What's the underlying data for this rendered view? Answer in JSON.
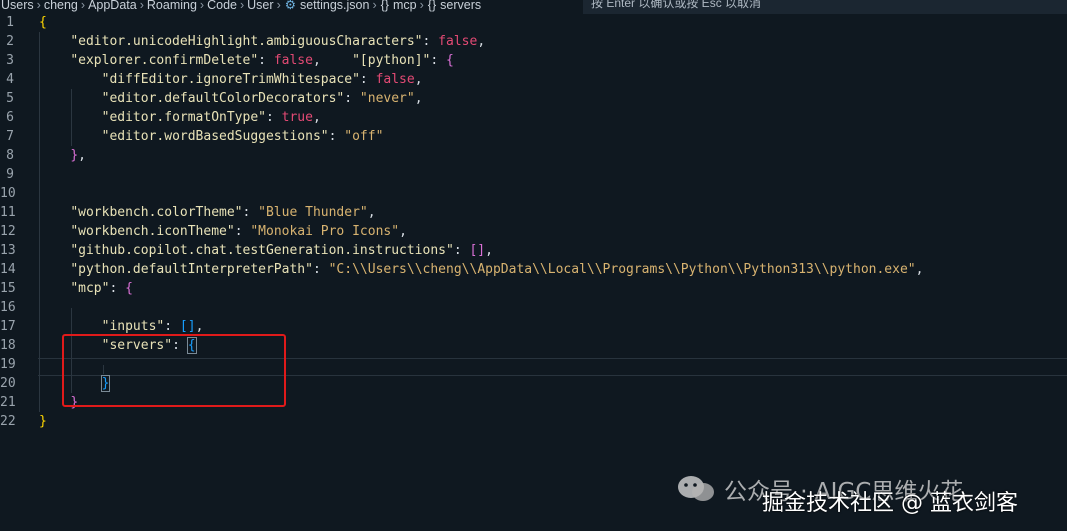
{
  "breadcrumb": {
    "items": [
      "Users",
      "cheng",
      "AppData",
      "Roaming",
      "Code",
      "User",
      "settings.json",
      "mcp",
      "servers"
    ]
  },
  "hint": {
    "text": "按 Enter 以确认或按 Esc 以取消"
  },
  "editor": {
    "line_numbers": [
      "1",
      "2",
      "3",
      "4",
      "5",
      "6",
      "7",
      "8",
      "9",
      "10",
      "11",
      "12",
      "13",
      "14",
      "15",
      "16",
      "17",
      "18",
      "19",
      "20",
      "21",
      "22"
    ],
    "lines": {
      "l1_open": "{",
      "l2_key": "\"editor.unicodeHighlight.ambiguousCharacters\"",
      "l2_val": "false",
      "l3_key": "\"explorer.confirmDelete\"",
      "l3_val": "false",
      "l3_key2": "\"[python]\"",
      "l3_brace": "{",
      "l4_key": "\"diffEditor.ignoreTrimWhitespace\"",
      "l4_val": "false",
      "l5_key": "\"editor.defaultColorDecorators\"",
      "l5_val": "\"never\"",
      "l6_key": "\"editor.formatOnType\"",
      "l6_val": "true",
      "l7_key": "\"editor.wordBasedSuggestions\"",
      "l7_val": "\"off\"",
      "l8_close": "}",
      "l11_key": "\"workbench.colorTheme\"",
      "l11_val": "\"Blue Thunder\"",
      "l12_key": "\"workbench.iconTheme\"",
      "l12_val": "\"Monokai Pro Icons\"",
      "l13_key": "\"github.copilot.chat.testGeneration.instructions\"",
      "l13_val": "[]",
      "l14_key": "\"python.defaultInterpreterPath\"",
      "l14_val": "\"C:\\\\Users\\\\cheng\\\\AppData\\\\Local\\\\Programs\\\\Python\\\\Python313\\\\python.exe\"",
      "l15_key": "\"mcp\"",
      "l15_brace": "{",
      "l17_key": "\"inputs\"",
      "l17_val": "[]",
      "l18_key": "\"servers\"",
      "l18_brace": "{",
      "l20_close": "}",
      "l21_close": "}",
      "l22_close": "}"
    }
  },
  "watermark": {
    "line1": "公众号 · AIGC思维火花",
    "line2": "掘金技术社区 @ 蓝衣剑客"
  }
}
